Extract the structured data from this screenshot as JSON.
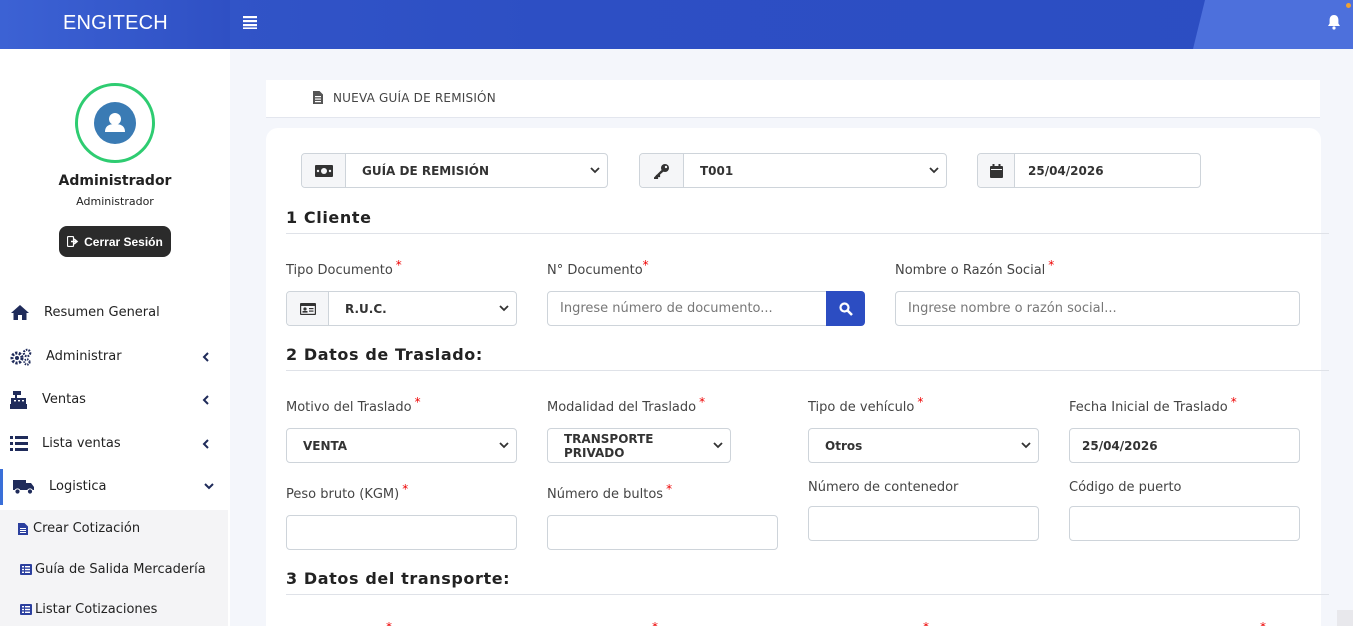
{
  "header": {
    "brand": "ENGITECH",
    "menu_icon": "bars-icon",
    "notif_icon": "bell-icon"
  },
  "user": {
    "name": "Administrador",
    "role": "Administrador",
    "logout_label": "Cerrar Sesión"
  },
  "sidebar": {
    "items": [
      {
        "label": "Resumen General",
        "icon": "home-icon"
      },
      {
        "label": "Administrar",
        "icon": "cogs-icon"
      },
      {
        "label": "Ventas",
        "icon": "cash-register-icon"
      },
      {
        "label": "Lista ventas",
        "icon": "list-icon"
      },
      {
        "label": "Logistica",
        "icon": "truck-icon"
      }
    ],
    "subitems": [
      {
        "label": "Crear Cotización",
        "icon": "file-icon"
      },
      {
        "label": "Guía de Salida Mercadería",
        "icon": "list-alt-icon"
      },
      {
        "label": "Listar Cotizaciones",
        "icon": "list-alt-icon"
      }
    ]
  },
  "page": {
    "title": "NUEVA GUÍA DE REMISIÓN"
  },
  "doc": {
    "type": "GUÍA DE REMISIÓN",
    "series": "T001",
    "date": "25/04/2026"
  },
  "sections": {
    "client": "1 Cliente",
    "transfer": "2 Datos de Traslado:",
    "transport": "3 Datos del transporte:"
  },
  "client": {
    "doc_type_label": "Tipo Documento",
    "doc_type_value": "R.U.C.",
    "doc_number_label": "N° Documento",
    "doc_number_placeholder": "Ingrese número de documento...",
    "name_label": "Nombre o Razón Social",
    "name_placeholder": "Ingrese nombre o razón social..."
  },
  "transfer": {
    "reason_label": "Motivo del Traslado",
    "reason_value": "VENTA",
    "mode_label": "Modalidad del Traslado",
    "mode_value": "TRANSPORTE PRIVADO",
    "vehicle_label": "Tipo de vehículo",
    "vehicle_value": "Otros",
    "start_date_label": "Fecha Inicial de Traslado",
    "start_date_value": "25/04/2026",
    "weight_label": "Peso bruto (KGM)",
    "packages_label": "Número de bultos",
    "container_label": "Número de contenedor",
    "port_label": "Código de puerto"
  },
  "required_mark": "*",
  "colors": {
    "primary": "#2c4dc2",
    "avatar_ring": "#2ecc71",
    "required": "#e00000"
  }
}
